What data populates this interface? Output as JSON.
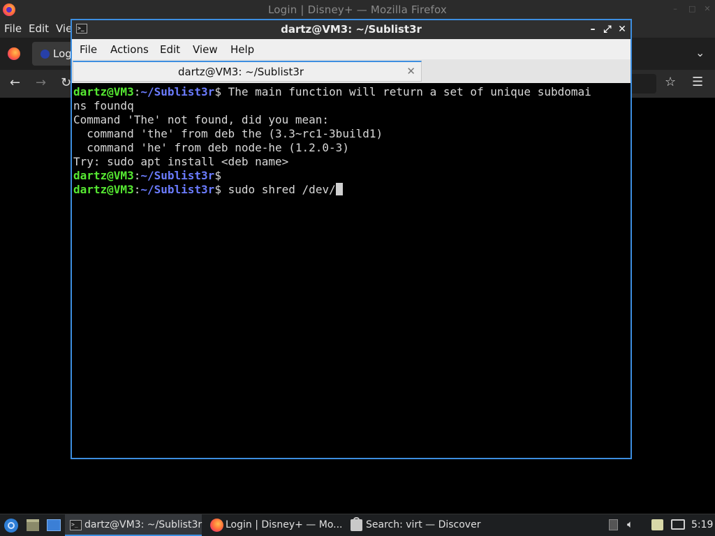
{
  "firefox": {
    "window_title": "Login | Disney+ — Mozilla Firefox",
    "menu": [
      "File",
      "Edit",
      "Vie"
    ],
    "tab_label": "Log",
    "win_buttons": [
      "–",
      "□",
      "✕"
    ]
  },
  "terminal": {
    "window_title": "dartz@VM3: ~/Sublist3r",
    "menu": [
      "File",
      "Actions",
      "Edit",
      "View",
      "Help"
    ],
    "tab_label": "dartz@VM3: ~/Sublist3r",
    "tab_close": "✕",
    "buttons": {
      "minimize": "–",
      "maximize": "⤢",
      "close": "✕"
    },
    "prompt_user": "dartz@VM3",
    "prompt_path": "~/Sublist3r",
    "lines": {
      "l1_cmd": " The main function will return a set of unique subdomai",
      "l2": "ns foundq",
      "l3": "Command 'The' not found, did you mean:",
      "l4": "  command 'the' from deb the (3.3~rc1-3build1)",
      "l5": "  command 'he' from deb node-he (1.2.0-3)",
      "l6": "Try: sudo apt install <deb name>",
      "l7_cmd": "",
      "l8_cmd": " sudo shred /dev/"
    }
  },
  "taskbar": {
    "items": [
      {
        "label": "dartz@VM3: ~/Sublist3r",
        "icon": "terminal-icon",
        "active": true
      },
      {
        "label": "Login | Disney+ — Mo...",
        "icon": "firefox-icon",
        "active": false
      },
      {
        "label": "Search: virt — Discover",
        "icon": "discover-icon",
        "active": false
      }
    ],
    "clock": "5:19",
    "accent": "#3d8ee0"
  }
}
